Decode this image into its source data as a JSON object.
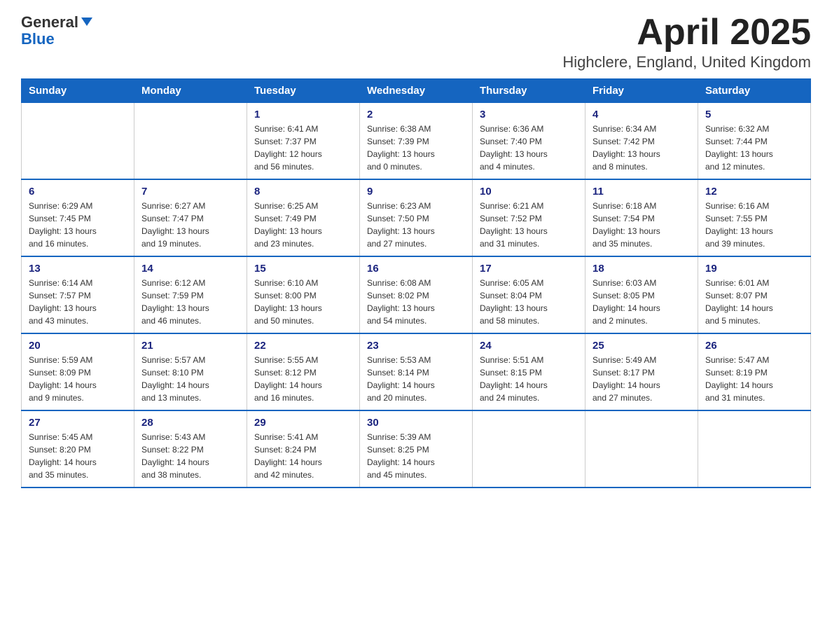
{
  "header": {
    "logo_general": "General",
    "logo_blue": "Blue",
    "month_title": "April 2025",
    "location": "Highclere, England, United Kingdom"
  },
  "days_of_week": [
    "Sunday",
    "Monday",
    "Tuesday",
    "Wednesday",
    "Thursday",
    "Friday",
    "Saturday"
  ],
  "weeks": [
    [
      {
        "day": "",
        "info": ""
      },
      {
        "day": "",
        "info": ""
      },
      {
        "day": "1",
        "info": "Sunrise: 6:41 AM\nSunset: 7:37 PM\nDaylight: 12 hours\nand 56 minutes."
      },
      {
        "day": "2",
        "info": "Sunrise: 6:38 AM\nSunset: 7:39 PM\nDaylight: 13 hours\nand 0 minutes."
      },
      {
        "day": "3",
        "info": "Sunrise: 6:36 AM\nSunset: 7:40 PM\nDaylight: 13 hours\nand 4 minutes."
      },
      {
        "day": "4",
        "info": "Sunrise: 6:34 AM\nSunset: 7:42 PM\nDaylight: 13 hours\nand 8 minutes."
      },
      {
        "day": "5",
        "info": "Sunrise: 6:32 AM\nSunset: 7:44 PM\nDaylight: 13 hours\nand 12 minutes."
      }
    ],
    [
      {
        "day": "6",
        "info": "Sunrise: 6:29 AM\nSunset: 7:45 PM\nDaylight: 13 hours\nand 16 minutes."
      },
      {
        "day": "7",
        "info": "Sunrise: 6:27 AM\nSunset: 7:47 PM\nDaylight: 13 hours\nand 19 minutes."
      },
      {
        "day": "8",
        "info": "Sunrise: 6:25 AM\nSunset: 7:49 PM\nDaylight: 13 hours\nand 23 minutes."
      },
      {
        "day": "9",
        "info": "Sunrise: 6:23 AM\nSunset: 7:50 PM\nDaylight: 13 hours\nand 27 minutes."
      },
      {
        "day": "10",
        "info": "Sunrise: 6:21 AM\nSunset: 7:52 PM\nDaylight: 13 hours\nand 31 minutes."
      },
      {
        "day": "11",
        "info": "Sunrise: 6:18 AM\nSunset: 7:54 PM\nDaylight: 13 hours\nand 35 minutes."
      },
      {
        "day": "12",
        "info": "Sunrise: 6:16 AM\nSunset: 7:55 PM\nDaylight: 13 hours\nand 39 minutes."
      }
    ],
    [
      {
        "day": "13",
        "info": "Sunrise: 6:14 AM\nSunset: 7:57 PM\nDaylight: 13 hours\nand 43 minutes."
      },
      {
        "day": "14",
        "info": "Sunrise: 6:12 AM\nSunset: 7:59 PM\nDaylight: 13 hours\nand 46 minutes."
      },
      {
        "day": "15",
        "info": "Sunrise: 6:10 AM\nSunset: 8:00 PM\nDaylight: 13 hours\nand 50 minutes."
      },
      {
        "day": "16",
        "info": "Sunrise: 6:08 AM\nSunset: 8:02 PM\nDaylight: 13 hours\nand 54 minutes."
      },
      {
        "day": "17",
        "info": "Sunrise: 6:05 AM\nSunset: 8:04 PM\nDaylight: 13 hours\nand 58 minutes."
      },
      {
        "day": "18",
        "info": "Sunrise: 6:03 AM\nSunset: 8:05 PM\nDaylight: 14 hours\nand 2 minutes."
      },
      {
        "day": "19",
        "info": "Sunrise: 6:01 AM\nSunset: 8:07 PM\nDaylight: 14 hours\nand 5 minutes."
      }
    ],
    [
      {
        "day": "20",
        "info": "Sunrise: 5:59 AM\nSunset: 8:09 PM\nDaylight: 14 hours\nand 9 minutes."
      },
      {
        "day": "21",
        "info": "Sunrise: 5:57 AM\nSunset: 8:10 PM\nDaylight: 14 hours\nand 13 minutes."
      },
      {
        "day": "22",
        "info": "Sunrise: 5:55 AM\nSunset: 8:12 PM\nDaylight: 14 hours\nand 16 minutes."
      },
      {
        "day": "23",
        "info": "Sunrise: 5:53 AM\nSunset: 8:14 PM\nDaylight: 14 hours\nand 20 minutes."
      },
      {
        "day": "24",
        "info": "Sunrise: 5:51 AM\nSunset: 8:15 PM\nDaylight: 14 hours\nand 24 minutes."
      },
      {
        "day": "25",
        "info": "Sunrise: 5:49 AM\nSunset: 8:17 PM\nDaylight: 14 hours\nand 27 minutes."
      },
      {
        "day": "26",
        "info": "Sunrise: 5:47 AM\nSunset: 8:19 PM\nDaylight: 14 hours\nand 31 minutes."
      }
    ],
    [
      {
        "day": "27",
        "info": "Sunrise: 5:45 AM\nSunset: 8:20 PM\nDaylight: 14 hours\nand 35 minutes."
      },
      {
        "day": "28",
        "info": "Sunrise: 5:43 AM\nSunset: 8:22 PM\nDaylight: 14 hours\nand 38 minutes."
      },
      {
        "day": "29",
        "info": "Sunrise: 5:41 AM\nSunset: 8:24 PM\nDaylight: 14 hours\nand 42 minutes."
      },
      {
        "day": "30",
        "info": "Sunrise: 5:39 AM\nSunset: 8:25 PM\nDaylight: 14 hours\nand 45 minutes."
      },
      {
        "day": "",
        "info": ""
      },
      {
        "day": "",
        "info": ""
      },
      {
        "day": "",
        "info": ""
      }
    ]
  ]
}
